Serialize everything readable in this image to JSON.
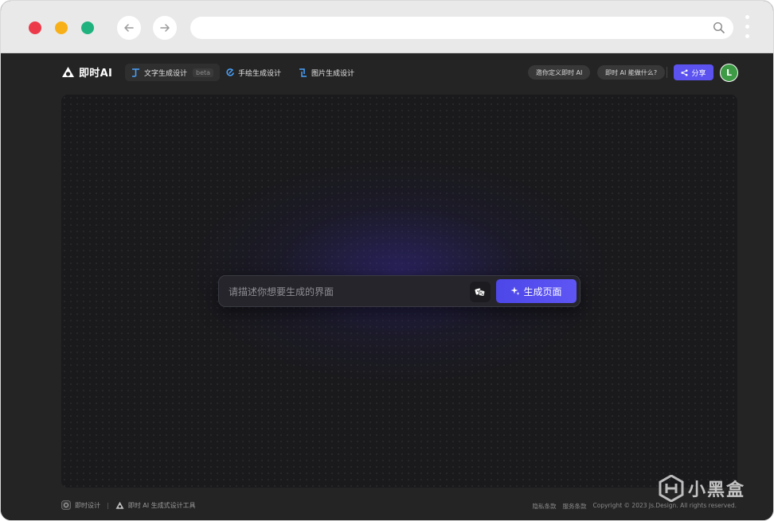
{
  "app": {
    "logo_text": "即时AI"
  },
  "tabs": [
    {
      "label": "文字生成设计",
      "badge": "beta",
      "active": true
    },
    {
      "label": "手绘生成设计"
    },
    {
      "label": "图片生成设计"
    }
  ],
  "header": {
    "pill_invite": "邀你定义即时 AI",
    "pill_what": "即时 AI 能做什么?",
    "share_label": "分享",
    "avatar_initial": "L"
  },
  "prompt": {
    "placeholder": "请描述你想要生成的界面",
    "generate_label": "生成页面"
  },
  "footer": {
    "brand": "即时设计",
    "tagline": "即时 AI 生成式设计工具",
    "privacy": "隐私条款",
    "terms": "服务条款",
    "copyright": "Copyright © 2023 Js.Design. All rights reserved."
  },
  "watermark": {
    "text": "小黑盒"
  },
  "colors": {
    "accent": "#5b52f0",
    "background": "#242424",
    "avatar": "#3d9a45"
  }
}
